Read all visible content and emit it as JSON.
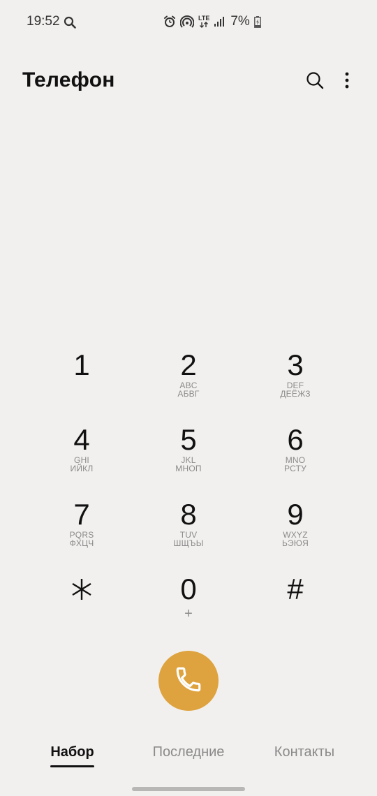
{
  "status_bar": {
    "time": "19:52",
    "network": "LTE",
    "battery": "7%"
  },
  "header": {
    "title": "Телефон",
    "search_icon": "search-icon",
    "more_icon": "more-vertical-icon"
  },
  "keypad": {
    "keys": [
      {
        "digit": "1",
        "latin": "",
        "cyrillic": ""
      },
      {
        "digit": "2",
        "latin": "ABC",
        "cyrillic": "АБВГ"
      },
      {
        "digit": "3",
        "latin": "DEF",
        "cyrillic": "ДЕЁЖЗ"
      },
      {
        "digit": "4",
        "latin": "GHI",
        "cyrillic": "ИЙКЛ"
      },
      {
        "digit": "5",
        "latin": "JKL",
        "cyrillic": "МНОП"
      },
      {
        "digit": "6",
        "latin": "MNO",
        "cyrillic": "РСТУ"
      },
      {
        "digit": "7",
        "latin": "PQRS",
        "cyrillic": "ФХЦЧ"
      },
      {
        "digit": "8",
        "latin": "TUV",
        "cyrillic": "ШЩЪЫ"
      },
      {
        "digit": "9",
        "latin": "WXYZ",
        "cyrillic": "ЬЭЮЯ"
      },
      {
        "digit": "*",
        "latin": "",
        "cyrillic": ""
      },
      {
        "digit": "0",
        "latin": "+",
        "cyrillic": ""
      },
      {
        "digit": "#",
        "latin": "",
        "cyrillic": ""
      }
    ]
  },
  "call_button": {
    "icon": "phone-icon",
    "color": "#dea33e"
  },
  "tabs": [
    {
      "label": "Набор",
      "active": true
    },
    {
      "label": "Последние",
      "active": false
    },
    {
      "label": "Контакты",
      "active": false
    }
  ]
}
